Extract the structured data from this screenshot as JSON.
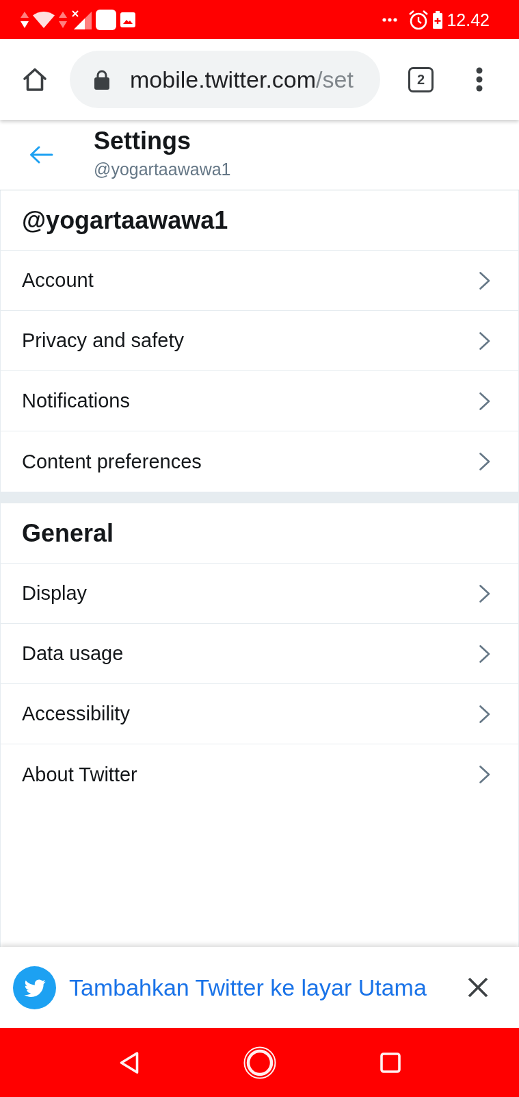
{
  "status_bar": {
    "time": "12.42"
  },
  "browser": {
    "url_host": "mobile.twitter.com",
    "url_path": "/set",
    "tab_count": "2"
  },
  "header": {
    "title": "Settings",
    "subtitle": "@yogartaawawa1"
  },
  "sections": [
    {
      "title": "@yogartaawawa1",
      "items": [
        {
          "label": "Account"
        },
        {
          "label": "Privacy and safety"
        },
        {
          "label": "Notifications"
        },
        {
          "label": "Content preferences"
        }
      ]
    },
    {
      "title": "General",
      "items": [
        {
          "label": "Display"
        },
        {
          "label": "Data usage"
        },
        {
          "label": "Accessibility"
        },
        {
          "label": "About Twitter"
        }
      ]
    }
  ],
  "banner": {
    "text": "Tambahkan Twitter ke layar Utama"
  }
}
